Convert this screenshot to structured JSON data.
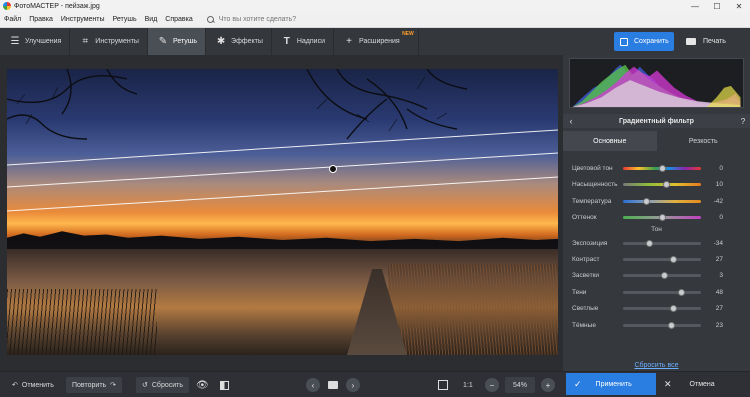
{
  "window": {
    "title": "ФотоМАСТЕР - пейзаж.jpg"
  },
  "menu": {
    "items": [
      "Файл",
      "Правка",
      "Инструменты",
      "Ретушь",
      "Вид",
      "Справка"
    ],
    "search_placeholder": "Что вы хотите сделать?"
  },
  "toolbar": {
    "tabs": [
      {
        "label": "Улучшения",
        "icon": "sliders-icon"
      },
      {
        "label": "Инструменты",
        "icon": "crop-icon"
      },
      {
        "label": "Ретушь",
        "icon": "brush-icon",
        "active": true
      },
      {
        "label": "Эффекты",
        "icon": "magic-wand-icon"
      },
      {
        "label": "Надписи",
        "icon": "text-icon"
      },
      {
        "label": "Расширения",
        "icon": "plus-icon",
        "badge": "NEW"
      }
    ],
    "save_label": "Сохранить",
    "print_label": "Печать"
  },
  "panel": {
    "title": "Градиентный фильтр",
    "help": "?",
    "subtabs": [
      "Основные",
      "Резкость"
    ],
    "sliders": [
      {
        "label": "Цветовой тон",
        "value": "0",
        "pos": 0.5,
        "track": "hue"
      },
      {
        "label": "Насыщенность",
        "value": "10",
        "pos": 0.55,
        "track": "sat"
      },
      {
        "label": "Температура",
        "value": "-42",
        "pos": 0.29,
        "track": "temp"
      },
      {
        "label": "Оттенок",
        "value": "0",
        "pos": 0.5,
        "track": "tint"
      },
      {
        "label": "Экспозиция",
        "value": "-34",
        "pos": 0.33,
        "track": "grey"
      },
      {
        "label": "Контраст",
        "value": "27",
        "pos": 0.64,
        "track": "grey"
      },
      {
        "label": "Засветки",
        "value": "3",
        "pos": 0.52,
        "track": "grey"
      },
      {
        "label": "Тени",
        "value": "48",
        "pos": 0.74,
        "track": "grey"
      },
      {
        "label": "Светлые",
        "value": "27",
        "pos": 0.64,
        "track": "grey"
      },
      {
        "label": "Тёмные",
        "value": "23",
        "pos": 0.62,
        "track": "grey"
      }
    ],
    "tone_label": "Тон",
    "reset_all": "Сбросить все"
  },
  "bottom": {
    "undo": "Отменить",
    "redo": "Повторить",
    "reset": "Сбросить",
    "zoom_1to1": "1:1",
    "zoom": "54%",
    "apply": "Применить",
    "cancel": "Отмена"
  },
  "colors": {
    "accent": "#2a7de1",
    "new_badge": "#ff9d2b",
    "link": "#6ab0ff"
  }
}
